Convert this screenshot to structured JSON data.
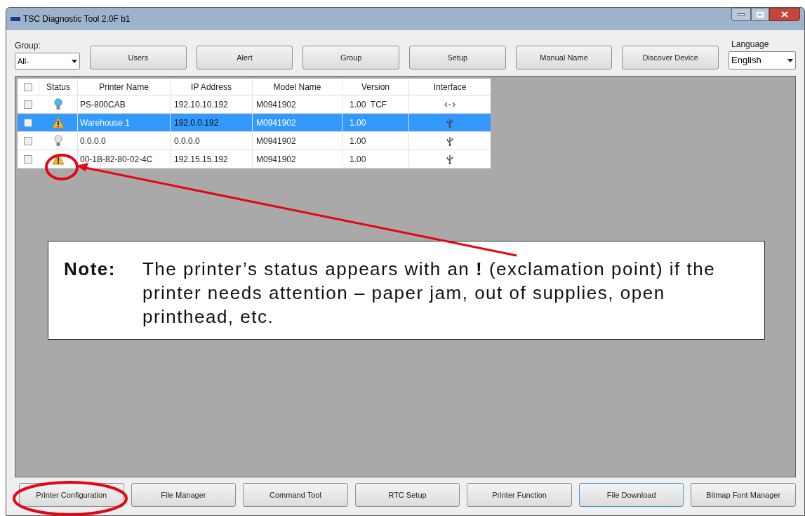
{
  "window": {
    "title": "TSC Diagnostic Tool 2.0F b1"
  },
  "group_filter": {
    "label": "Group:",
    "value": "All-"
  },
  "toolbar_buttons": [
    "Users",
    "Alert",
    "Group",
    "Setup",
    "Manual Name",
    "Discover Device"
  ],
  "language": {
    "label": "Language",
    "value": "English"
  },
  "table": {
    "select_all": {
      "checked": false
    },
    "columns": [
      "Status",
      "Printer Name",
      "IP Address",
      "Model Name",
      "Version",
      "Interface"
    ],
    "rows": [
      {
        "checked": false,
        "selected": false,
        "status": {
          "kind": "online"
        },
        "name": "PS-800CAB",
        "ip": "192.10.10.192",
        "model": "M0941902",
        "version": "1.00  TCF",
        "interface": {
          "kind": "ethernet"
        }
      },
      {
        "checked": false,
        "selected": true,
        "status": {
          "kind": "warning"
        },
        "name": "Warehouse 1",
        "ip": "192.0.0.192",
        "model": "M0941902",
        "version": "1.00",
        "interface": {
          "kind": "usb"
        }
      },
      {
        "checked": false,
        "selected": false,
        "status": {
          "kind": "offline"
        },
        "name": "0.0.0.0",
        "ip": "0.0.0.0",
        "model": "M0941902",
        "version": "1.00",
        "interface": {
          "kind": "usb"
        }
      },
      {
        "checked": false,
        "selected": false,
        "status": {
          "kind": "warning"
        },
        "name": "00-1B-82-80-02-4C",
        "ip": "192.15.15.192",
        "model": "M0941902",
        "version": "1.00",
        "interface": {
          "kind": "usb"
        }
      }
    ]
  },
  "note": {
    "label": "Note:",
    "text": "The printer’s status appears with an **!** (exclamation point) if the printer needs attention – paper jam, out of supplies, open printhead, etc."
  },
  "bottom_buttons": [
    {
      "label": "Printer Configuration",
      "focused": false
    },
    {
      "label": "File Manager",
      "focused": false
    },
    {
      "label": "Command Tool",
      "focused": false
    },
    {
      "label": "RTC Setup",
      "focused": false
    },
    {
      "label": "Printer Function",
      "focused": false
    },
    {
      "label": "File Download",
      "focused": true
    },
    {
      "label": "Bitmap Font Manager",
      "focused": false
    }
  ]
}
